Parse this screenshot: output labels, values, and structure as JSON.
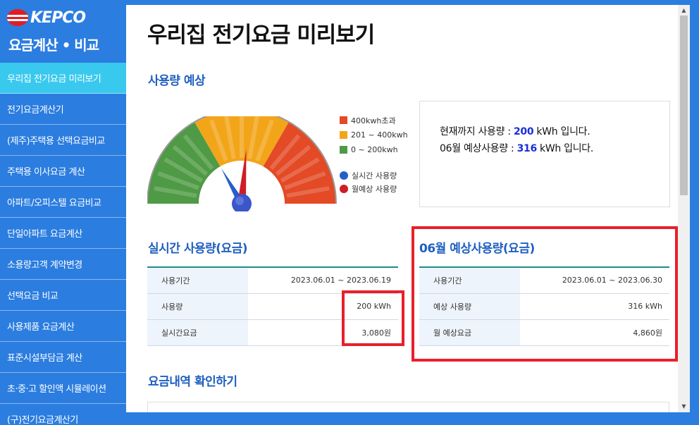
{
  "sidebar": {
    "logo_text": "KEPCO",
    "app_title": "요금계산 • 비교",
    "items": [
      {
        "label": "우리집 전기요금 미리보기"
      },
      {
        "label": "전기요금계산기"
      },
      {
        "label": "(제주)주택용 선택요금비교"
      },
      {
        "label": "주택용 이사요금 계산"
      },
      {
        "label": "아파트/오피스텔 요금비교"
      },
      {
        "label": "단일아파트 요금계산"
      },
      {
        "label": "소용량고객 계약변경"
      },
      {
        "label": "선택요금 비교"
      },
      {
        "label": "사용제품 요금계산"
      },
      {
        "label": "표준시설부담금 계산"
      },
      {
        "label": "초·중·고 할인액 시뮬레이션"
      },
      {
        "label": "(구)전기요금계산기"
      }
    ]
  },
  "main": {
    "page_title": "우리집 전기요금 미리보기",
    "usage_forecast_title": "사용량 예상",
    "gauge": {
      "realtime_usage_kwh": 200,
      "forecast_usage_kwh": 316,
      "legend": [
        {
          "label": "400kwh초과",
          "color": "#e34a25"
        },
        {
          "label": "201 ~ 400kwh",
          "color": "#f3a51a"
        },
        {
          "label": "0 ~ 200kwh",
          "color": "#4f9a45"
        }
      ],
      "needles": [
        {
          "label": "실시간 사용량",
          "color": "#2460c8"
        },
        {
          "label": "월예상 사용량",
          "color": "#cf1d27"
        }
      ]
    },
    "info": {
      "line1_prefix": "현재까지 사용량 : ",
      "line1_value": "200",
      "line1_suffix": " kWh 입니다.",
      "line2_prefix": "06월 예상사용량 : ",
      "line2_value": "316",
      "line2_suffix": " kWh 입니다."
    },
    "realtime": {
      "title": "실시간 사용량(요금)",
      "rows": [
        {
          "key": "사용기간",
          "value": "2023.06.01 ~ 2023.06.19"
        },
        {
          "key": "사용량",
          "value": "200 kWh"
        },
        {
          "key": "실시간요금",
          "value": "3,080원"
        }
      ]
    },
    "forecast": {
      "title": "06월 예상사용량(요금)",
      "rows": [
        {
          "key": "사용기간",
          "value": "2023.06.01 ~ 2023.06.30"
        },
        {
          "key": "예상 사용량",
          "value": "316 kWh"
        },
        {
          "key": "월 예상요금",
          "value": "4,860원"
        }
      ]
    },
    "detail_title": "요금내역 확인하기"
  }
}
